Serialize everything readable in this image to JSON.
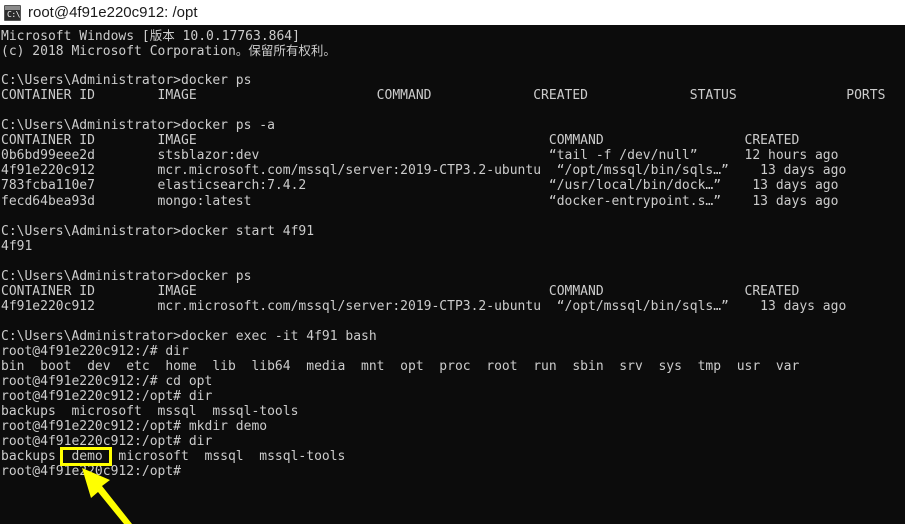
{
  "window": {
    "title": "root@4f91e220c912: /opt",
    "icon": "console-icon",
    "titlebar_bg": "#ffffff",
    "titlebar_fg": "#1a1a1a",
    "console_bg": "#0c0c0c",
    "console_fg": "#cccccc"
  },
  "annotations": {
    "highlight_color": "#ffff00",
    "highlighted_text": "demo",
    "arrow_color": "#ffff00",
    "arrow_points_to": "demo"
  },
  "console": {
    "lines": [
      "Microsoft Windows [版本 10.0.17763.864]",
      "(c) 2018 Microsoft Corporation。保留所有权利。",
      "",
      "C:\\Users\\Administrator>docker ps",
      "CONTAINER ID        IMAGE                       COMMAND             CREATED             STATUS              PORTS",
      "",
      "C:\\Users\\Administrator>docker ps -a",
      "CONTAINER ID        IMAGE                                             COMMAND                  CREATED",
      "0b6bd99eee2d        stsblazor:dev                                     “tail -f /dev/null”      12 hours ago",
      "4f91e220c912        mcr.microsoft.com/mssql/server:2019-CTP3.2-ubuntu  “/opt/mssql/bin/sqls…”    13 days ago",
      "783fcba110e7        elasticsearch:7.4.2                               “/usr/local/bin/dock…”    13 days ago",
      "fecd64bea93d        mongo:latest                                      “docker-entrypoint.s…”    13 days ago",
      "",
      "C:\\Users\\Administrator>docker start 4f91",
      "4f91",
      "",
      "C:\\Users\\Administrator>docker ps",
      "CONTAINER ID        IMAGE                                             COMMAND                  CREATED",
      "4f91e220c912        mcr.microsoft.com/mssql/server:2019-CTP3.2-ubuntu  “/opt/mssql/bin/sqls…”    13 days ago",
      "",
      "C:\\Users\\Administrator>docker exec -it 4f91 bash",
      "root@4f91e220c912:/# dir",
      "bin  boot  dev  etc  home  lib  lib64  media  mnt  opt  proc  root  run  sbin  srv  sys  tmp  usr  var",
      "root@4f91e220c912:/# cd opt",
      "root@4f91e220c912:/opt# dir",
      "backups  microsoft  mssql  mssql-tools",
      "root@4f91e220c912:/opt# mkdir demo",
      "root@4f91e220c912:/opt# dir",
      "backups  demo  microsoft  mssql  mssql-tools",
      "root@4f91e220c912:/opt#"
    ]
  }
}
